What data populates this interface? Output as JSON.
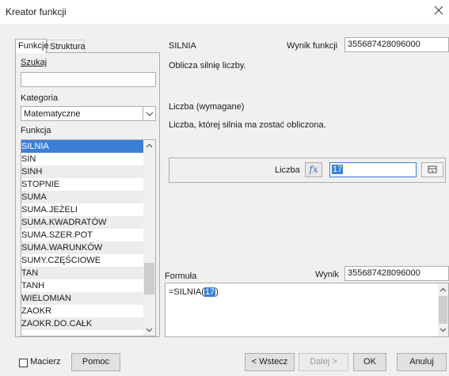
{
  "window": {
    "title": "Kreator funkcji"
  },
  "tabs": [
    {
      "label": "Funkcje"
    },
    {
      "label": "Struktura"
    }
  ],
  "left": {
    "search_label": "Szukaj",
    "search_value": "",
    "category_label": "Kategoria",
    "category_value": "Matematyczne",
    "function_label": "Funkcja",
    "functions": [
      "SILNIA",
      "SIN",
      "SINH",
      "STOPNIE",
      "SUMA",
      "SUMA.JEŻELI",
      "SUMA.KWADRATÓW",
      "SUMA.SZER.POT",
      "SUMA.WARUNKÓW",
      "SUMY.CZĘŚCIOWE",
      "TAN",
      "TANH",
      "WIELOMIAN",
      "ZAOKR",
      "ZAOKR.DO.CAŁK"
    ],
    "selected_function": "SILNIA"
  },
  "right": {
    "function_name": "SILNIA",
    "result_label": "Wynik funkcji",
    "result_value": "355687428096000",
    "description": "Oblicza silnię liczby.",
    "param_header": "Liczba (wymagane)",
    "param_description": "Liczba, której silnia ma zostać obliczona.",
    "param_label": "Liczba",
    "param_value": "17",
    "formula_label": "Formuła",
    "formula_result_label": "Wynik",
    "formula_result_value": "355687428096000",
    "formula_prefix": "=SILNIA(",
    "formula_arg": "17",
    "formula_suffix": ")"
  },
  "bottom": {
    "matrix_label": "Macierz",
    "help_label": "Pomoc",
    "back_label": "< Wstecz",
    "next_label": "Dalej >",
    "ok_label": "OK",
    "cancel_label": "Anuluj"
  },
  "icons": {
    "close": "close-icon",
    "fx": "fx-icon",
    "shrink": "shrink-icon",
    "dropdown": "chevron-down-icon"
  },
  "colors": {
    "selection": "#3c7fd6",
    "fx_text": "#3b6fb8"
  }
}
